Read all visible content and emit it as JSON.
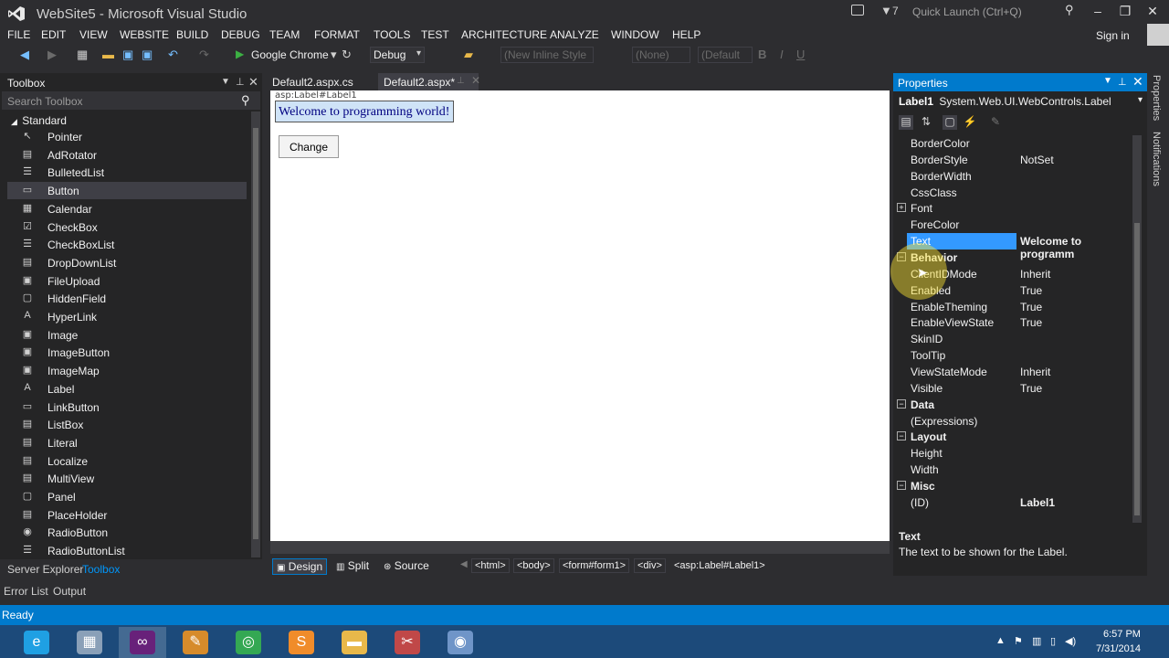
{
  "window": {
    "title": "WebSite5 - Microsoft Visual Studio",
    "filter_count": "7",
    "quick_launch_placeholder": "Quick Launch (Ctrl+Q)"
  },
  "menu": [
    "FILE",
    "EDIT",
    "VIEW",
    "WEBSITE",
    "BUILD",
    "DEBUG",
    "TEAM",
    "FORMAT",
    "TOOLS",
    "TEST",
    "ARCHITECTURE",
    "ANALYZE",
    "WINDOW",
    "HELP"
  ],
  "signin": "Sign in",
  "toolbar": {
    "run_label": "Google Chrome",
    "config": "Debug",
    "style_combo": "(New Inline Style",
    "block_combo": "(None)",
    "font_combo": "(Default",
    "bold": "B",
    "italic": "I",
    "underline": "U"
  },
  "toolbox": {
    "title": "Toolbox",
    "search_placeholder": "Search Toolbox",
    "group": "Standard",
    "items": [
      {
        "label": "Pointer",
        "icon": "pointer-icon",
        "glyph": "↖"
      },
      {
        "label": "AdRotator",
        "icon": "adrotator-icon",
        "glyph": "▤"
      },
      {
        "label": "BulletedList",
        "icon": "bulletedlist-icon",
        "glyph": "☰"
      },
      {
        "label": "Button",
        "icon": "button-icon",
        "glyph": "▭"
      },
      {
        "label": "Calendar",
        "icon": "calendar-icon",
        "glyph": "▦"
      },
      {
        "label": "CheckBox",
        "icon": "checkbox-icon",
        "glyph": "☑"
      },
      {
        "label": "CheckBoxList",
        "icon": "checkboxlist-icon",
        "glyph": "☰"
      },
      {
        "label": "DropDownList",
        "icon": "dropdownlist-icon",
        "glyph": "▤"
      },
      {
        "label": "FileUpload",
        "icon": "fileupload-icon",
        "glyph": "▣"
      },
      {
        "label": "HiddenField",
        "icon": "hiddenfield-icon",
        "glyph": "▢"
      },
      {
        "label": "HyperLink",
        "icon": "hyperlink-icon",
        "glyph": "A"
      },
      {
        "label": "Image",
        "icon": "image-icon",
        "glyph": "▣"
      },
      {
        "label": "ImageButton",
        "icon": "imagebutton-icon",
        "glyph": "▣"
      },
      {
        "label": "ImageMap",
        "icon": "imagemap-icon",
        "glyph": "▣"
      },
      {
        "label": "Label",
        "icon": "label-icon",
        "glyph": "A"
      },
      {
        "label": "LinkButton",
        "icon": "linkbutton-icon",
        "glyph": "▭"
      },
      {
        "label": "ListBox",
        "icon": "listbox-icon",
        "glyph": "▤"
      },
      {
        "label": "Literal",
        "icon": "literal-icon",
        "glyph": "▤"
      },
      {
        "label": "Localize",
        "icon": "localize-icon",
        "glyph": "▤"
      },
      {
        "label": "MultiView",
        "icon": "multiview-icon",
        "glyph": "▤"
      },
      {
        "label": "Panel",
        "icon": "panel-icon",
        "glyph": "▢"
      },
      {
        "label": "PlaceHolder",
        "icon": "placeholder-icon",
        "glyph": "▤"
      },
      {
        "label": "RadioButton",
        "icon": "radiobutton-icon",
        "glyph": "◉"
      },
      {
        "label": "RadioButtonList",
        "icon": "radiobuttonlist-icon",
        "glyph": "☰"
      }
    ],
    "selected": "Button"
  },
  "panel_tabs": {
    "server_explorer": "Server Explorer",
    "toolbox": "Toolbox",
    "error_list": "Error List",
    "output": "Output"
  },
  "documents": {
    "tabs": [
      "Default2.aspx.cs",
      "Default2.aspx*"
    ],
    "active": "Default2.aspx*"
  },
  "designer": {
    "label_tag": "asp:Label#Label1",
    "label_text": "Welcome to programming world!",
    "button_text": "Change",
    "views": [
      "Design",
      "Split",
      "Source"
    ],
    "active_view": "Design",
    "breadcrumbs": [
      "<html>",
      "<body>",
      "<form#form1>",
      "<div>",
      "<asp:Label#Label1>"
    ]
  },
  "properties": {
    "title": "Properties",
    "object_name": "Label1",
    "object_type": "System.Web.UI.WebControls.Label",
    "rows": [
      {
        "kind": "prop",
        "name": "BorderColor",
        "value": ""
      },
      {
        "kind": "prop",
        "name": "BorderStyle",
        "value": "NotSet"
      },
      {
        "kind": "prop",
        "name": "BorderWidth",
        "value": ""
      },
      {
        "kind": "prop",
        "name": "CssClass",
        "value": ""
      },
      {
        "kind": "expandable",
        "name": "Font",
        "value": ""
      },
      {
        "kind": "prop",
        "name": "ForeColor",
        "value": ""
      },
      {
        "kind": "selected",
        "name": "Text",
        "value": "Welcome to programm"
      },
      {
        "kind": "category",
        "name": "Behavior",
        "value": ""
      },
      {
        "kind": "prop",
        "name": "ClientIDMode",
        "value": "Inherit"
      },
      {
        "kind": "prop",
        "name": "Enabled",
        "value": "True"
      },
      {
        "kind": "prop",
        "name": "EnableTheming",
        "value": "True"
      },
      {
        "kind": "prop",
        "name": "EnableViewState",
        "value": "True"
      },
      {
        "kind": "prop",
        "name": "SkinID",
        "value": ""
      },
      {
        "kind": "prop",
        "name": "ToolTip",
        "value": ""
      },
      {
        "kind": "prop",
        "name": "ViewStateMode",
        "value": "Inherit"
      },
      {
        "kind": "prop",
        "name": "Visible",
        "value": "True"
      },
      {
        "kind": "category",
        "name": "Data",
        "value": ""
      },
      {
        "kind": "prop",
        "name": "(Expressions)",
        "value": ""
      },
      {
        "kind": "category",
        "name": "Layout",
        "value": ""
      },
      {
        "kind": "prop",
        "name": "Height",
        "value": ""
      },
      {
        "kind": "prop",
        "name": "Width",
        "value": ""
      },
      {
        "kind": "category",
        "name": "Misc",
        "value": ""
      },
      {
        "kind": "prop",
        "name": "(ID)",
        "value": "Label1",
        "bold": true
      }
    ],
    "desc_title": "Text",
    "desc_text": "The text to be shown for the Label."
  },
  "side_tabs": [
    "Properties",
    "Notifications"
  ],
  "status": "Ready",
  "taskbar": {
    "apps": [
      {
        "icon": "internet-explorer-icon",
        "glyph": "e",
        "color": "#1fa0e3"
      },
      {
        "icon": "calculator-icon",
        "glyph": "▦",
        "color": "#8aa0b8"
      },
      {
        "icon": "visual-studio-icon",
        "glyph": "∞",
        "color": "#68217a"
      },
      {
        "icon": "paint-icon",
        "glyph": "✎",
        "color": "#d68b2b"
      },
      {
        "icon": "chrome-icon",
        "glyph": "◎",
        "color": "#34a853"
      },
      {
        "icon": "sublime-icon",
        "glyph": "S",
        "color": "#f08c2a"
      },
      {
        "icon": "file-explorer-icon",
        "glyph": "▬",
        "color": "#e8b84a"
      },
      {
        "icon": "snipping-tool-icon",
        "glyph": "✂",
        "color": "#c04848"
      },
      {
        "icon": "recorder-icon",
        "glyph": "◉",
        "color": "#6f95c8"
      }
    ],
    "active_index": 2,
    "time": "6:57 PM",
    "date": "7/31/2014"
  },
  "colors": {
    "accent": "#007acc",
    "background": "#2d2d30",
    "panel": "#252526",
    "selection": "#3399ff"
  }
}
